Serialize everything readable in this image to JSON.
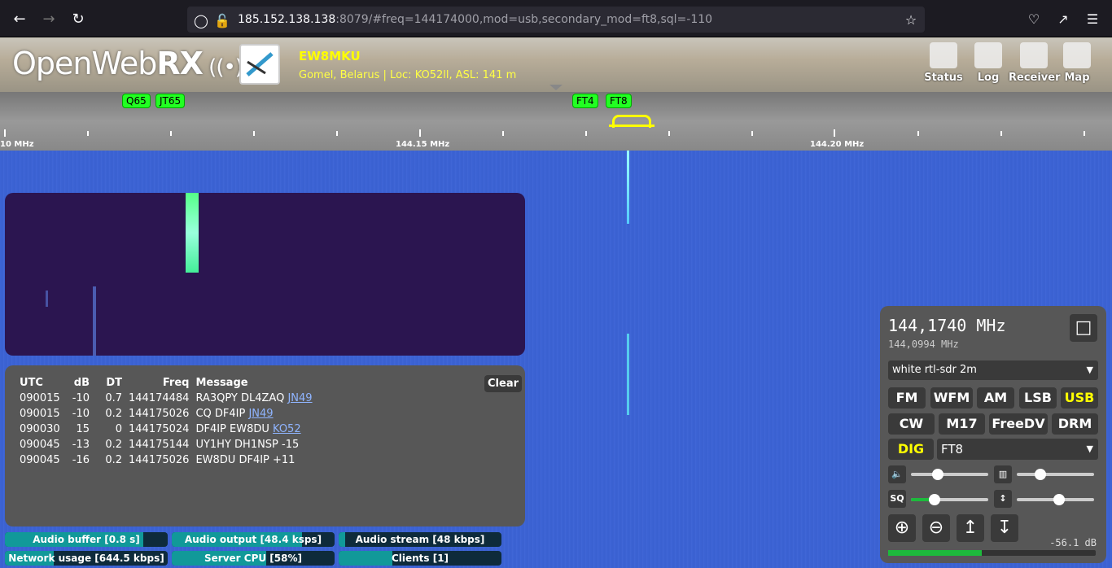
{
  "browser": {
    "url_host": "185.152.138.138",
    "url_rest": ":8079/#freq=144174000,mod=usb,secondary_mod=ft8,sql=-110"
  },
  "header": {
    "logo_text_1": "Open",
    "logo_text_2": "Web",
    "logo_text_3": "RX",
    "receiver_name": "EW8MKU",
    "receiver_location": "Gomel, Belarus | Loc: KO52ll, ASL: 141 m",
    "buttons": [
      "Status",
      "Log",
      "Receiver",
      "Map"
    ]
  },
  "scale": {
    "bookmarks": [
      "Q65",
      "JT65",
      "FT4",
      "FT8"
    ],
    "labels": [
      "10 MHz",
      "144.15 MHz",
      "144.20 MHz"
    ]
  },
  "ft8": {
    "headers": [
      "UTC",
      "dB",
      "DT",
      "Freq",
      "Message"
    ],
    "clear_label": "Clear",
    "rows": [
      {
        "utc": "090015",
        "db": "-10",
        "dt": "0.7",
        "freq": "144174484",
        "msg": "RA3QPY DL4ZAQ ",
        "loc": "JN49"
      },
      {
        "utc": "090015",
        "db": "-10",
        "dt": "0.2",
        "freq": "144175026",
        "msg": "CQ DF4IP ",
        "loc": "JN49"
      },
      {
        "utc": "090030",
        "db": "15",
        "dt": "0",
        "freq": "144175024",
        "msg": "DF4IP EW8DU ",
        "loc": "KO52"
      },
      {
        "utc": "090045",
        "db": "-13",
        "dt": "0.2",
        "freq": "144175144",
        "msg": "UY1HY DH1NSP -15",
        "loc": ""
      },
      {
        "utc": "090045",
        "db": "-16",
        "dt": "0.2",
        "freq": "144175026",
        "msg": "EW8DU DF4IP +11",
        "loc": ""
      }
    ]
  },
  "status_bars": {
    "audio_buffer": {
      "label": "Audio buffer [0.8 s]",
      "level": 0.85
    },
    "audio_output": {
      "label": "Audio output [48.4 ksps]",
      "level": 0.8
    },
    "audio_stream": {
      "label": "Audio stream [48 kbps]",
      "level": 0.04
    },
    "network_usage": {
      "label": "Network usage [644.5 kbps]",
      "level": 0.3
    },
    "server_cpu": {
      "label": "Server CPU [58%]",
      "level": 0.58
    },
    "clients": {
      "label": "Clients [1]",
      "level": 0.33
    }
  },
  "receiver": {
    "freq": "144,1740 MHz",
    "freq_sub": "144,0994 MHz",
    "profile": "white rtl-sdr 2m",
    "modes_row1": [
      "FM",
      "WFM",
      "AM",
      "LSB",
      "USB"
    ],
    "modes_row2": [
      "CW",
      "M17",
      "FreeDV",
      "DRM"
    ],
    "dig_label": "DIG",
    "dig_mode": "FT8",
    "volume_label": "",
    "squelch_label": "SQ",
    "volume_level": 0.35,
    "squelch_level": 0.3,
    "nr_level": 0.3,
    "eq_level": 0.55,
    "smeter_text": "-56.1 dB",
    "smeter_level": 0.45
  }
}
